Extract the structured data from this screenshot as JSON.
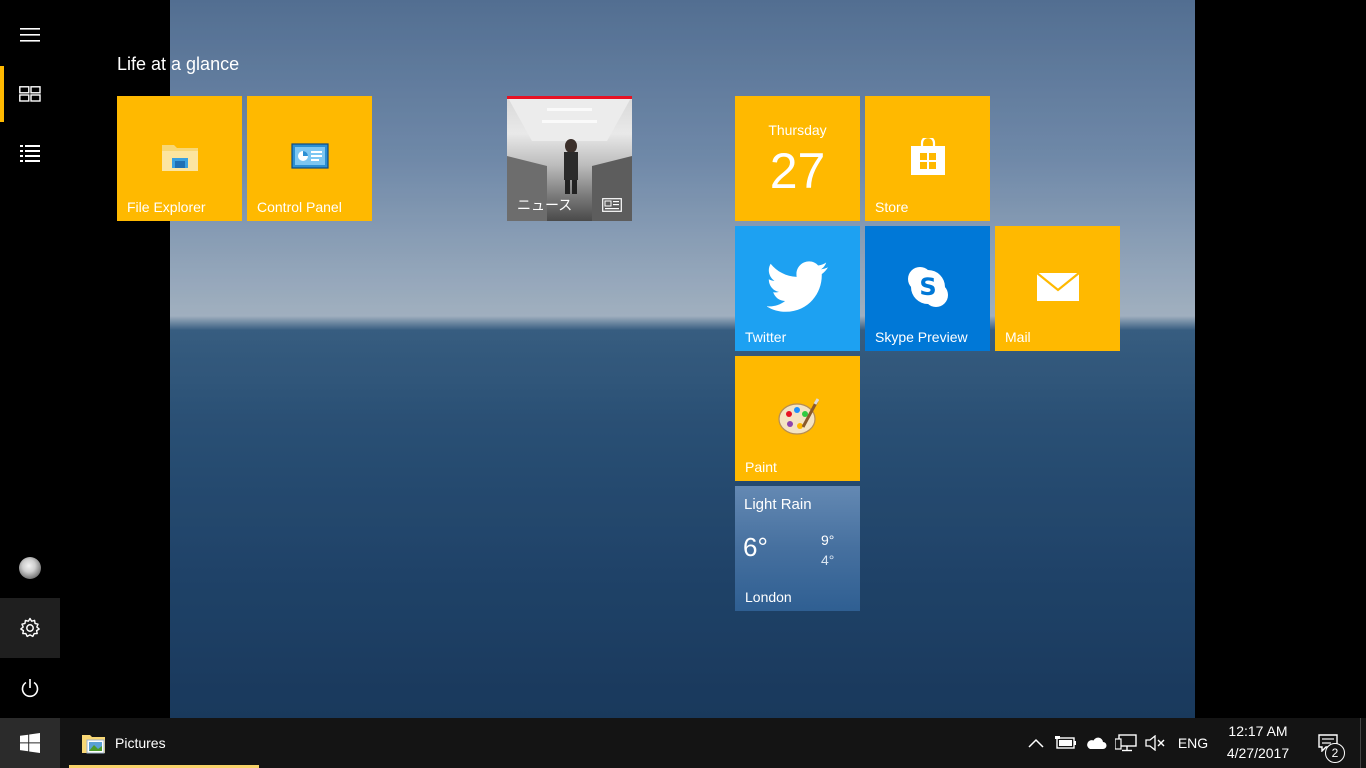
{
  "start": {
    "group_title": "Life at a glance",
    "tiles": {
      "file_explorer": {
        "label": "File Explorer",
        "icon": "folder-icon"
      },
      "control_panel": {
        "label": "Control Panel",
        "icon": "control-panel-icon"
      },
      "news": {
        "label": "ニュース",
        "icon": "news-icon"
      },
      "calendar": {
        "day_name": "Thursday",
        "day_number": "27"
      },
      "store": {
        "label": "Store",
        "icon": "store-bag-icon"
      },
      "twitter": {
        "label": "Twitter",
        "icon": "twitter-bird-icon"
      },
      "skype": {
        "label": "Skype Preview",
        "icon": "skype-icon"
      },
      "mail": {
        "label": "Mail",
        "icon": "envelope-icon"
      },
      "paint": {
        "label": "Paint",
        "icon": "paint-palette-icon"
      },
      "weather": {
        "condition": "Light Rain",
        "temp": "6°",
        "high": "9°",
        "low": "4°",
        "city": "London"
      }
    }
  },
  "rail": {
    "items": [
      "hamburger-icon",
      "tiles-view-icon",
      "all-apps-list-icon",
      "avatar",
      "gear-icon",
      "power-icon"
    ]
  },
  "taskbar": {
    "pinned_window": {
      "label": "Pictures",
      "icon": "pictures-folder-icon"
    },
    "tray": {
      "language": "ENG",
      "time": "12:17 AM",
      "date": "4/27/2017",
      "notifications_count": "2"
    }
  },
  "colors": {
    "accent": "#ffb900",
    "twitter": "#1da1f2",
    "skype": "#0078d7",
    "taskbar": "#141414"
  }
}
